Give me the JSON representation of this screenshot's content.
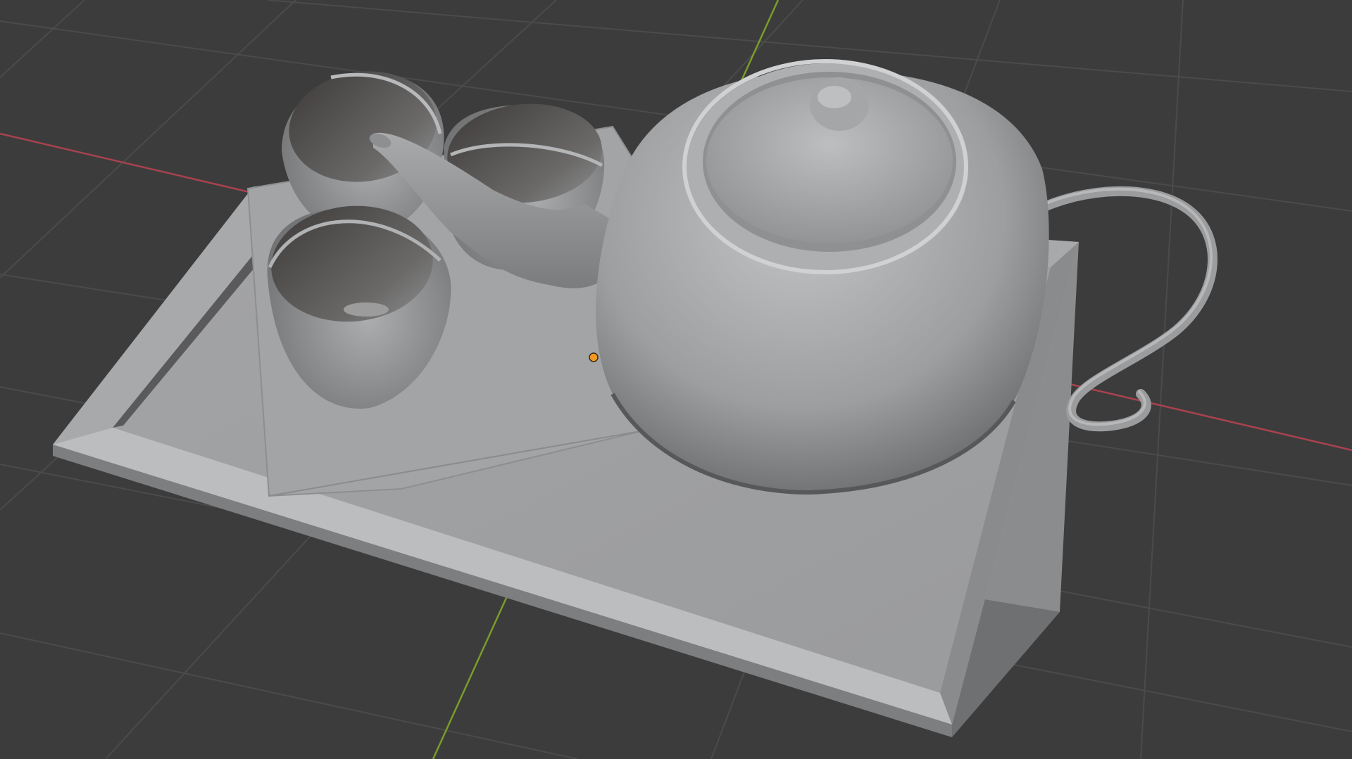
{
  "app": "3D viewport",
  "viewport": {
    "shading_mode": "solid",
    "background_color": "#3c3c3c",
    "grid_color": "#4b4b4b",
    "x_axis_color": "#a8424e",
    "y_axis_color": "#7a9c2a",
    "mesh_color": "#9e9fa1",
    "origin_color": "#f29a1f"
  },
  "scene": {
    "objects": [
      "tray",
      "napkin",
      "cup",
      "cup",
      "cup",
      "teapot"
    ]
  }
}
